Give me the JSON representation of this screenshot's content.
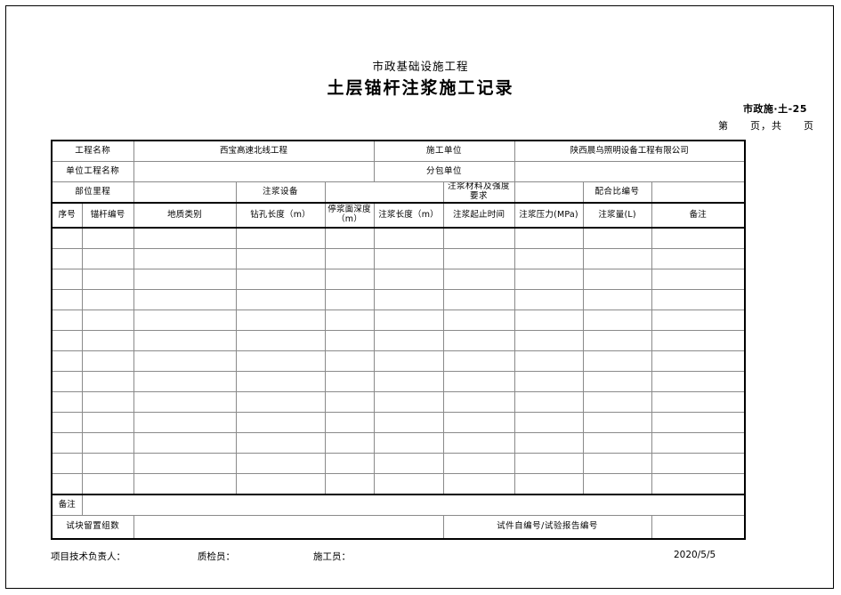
{
  "document": {
    "subtitle": "市政基础设施工程",
    "title": "土层锚杆注浆施工记录",
    "form_code": "市政施·土-25",
    "page_line": "第　　页，共　　页"
  },
  "info": {
    "project_name_label": "工程名称",
    "project_name_value": "西宝高速北线工程",
    "construction_unit_label": "施工单位",
    "construction_unit_value": "陕西晨乌照明设备工程有限公司",
    "unit_project_label": "单位工程名称",
    "unit_project_value": "",
    "subcontractor_label": "分包单位",
    "subcontractor_value": "",
    "location_mileage_label": "部位里程",
    "location_mileage_value": "",
    "grouting_equipment_label": "注浆设备",
    "grouting_equipment_value": "",
    "grouting_material_label": "注浆材料及强度要求",
    "grouting_material_value": "",
    "mix_ratio_label": "配合比编号",
    "mix_ratio_value": ""
  },
  "table": {
    "columns": [
      "序号",
      "锚杆编号",
      "地质类别",
      "钻孔长度（m）",
      "停浆面深度（m）",
      "注浆长度（m）",
      "注浆起止时间",
      "注浆压力(MPa)",
      "注浆量(L)",
      "备注"
    ],
    "rows": [
      [
        "",
        "",
        "",
        "",
        "",
        "",
        "",
        "",
        "",
        ""
      ],
      [
        "",
        "",
        "",
        "",
        "",
        "",
        "",
        "",
        "",
        ""
      ],
      [
        "",
        "",
        "",
        "",
        "",
        "",
        "",
        "",
        "",
        ""
      ],
      [
        "",
        "",
        "",
        "",
        "",
        "",
        "",
        "",
        "",
        ""
      ],
      [
        "",
        "",
        "",
        "",
        "",
        "",
        "",
        "",
        "",
        ""
      ],
      [
        "",
        "",
        "",
        "",
        "",
        "",
        "",
        "",
        "",
        ""
      ],
      [
        "",
        "",
        "",
        "",
        "",
        "",
        "",
        "",
        "",
        ""
      ],
      [
        "",
        "",
        "",
        "",
        "",
        "",
        "",
        "",
        "",
        ""
      ],
      [
        "",
        "",
        "",
        "",
        "",
        "",
        "",
        "",
        "",
        ""
      ],
      [
        "",
        "",
        "",
        "",
        "",
        "",
        "",
        "",
        "",
        ""
      ],
      [
        "",
        "",
        "",
        "",
        "",
        "",
        "",
        "",
        "",
        ""
      ],
      [
        "",
        "",
        "",
        "",
        "",
        "",
        "",
        "",
        "",
        ""
      ],
      [
        "",
        "",
        "",
        "",
        "",
        "",
        "",
        "",
        "",
        ""
      ]
    ]
  },
  "bottom": {
    "remark_label": "备注",
    "remark_value": "",
    "sample_groups_label": "试块留置组数",
    "sample_groups_value": "",
    "sample_code_label": "试件自编号/试验报告编号",
    "sample_code_value": ""
  },
  "footer": {
    "tech_lead": "项目技术负责人：",
    "inspector": "质检员：",
    "site_worker": "施工员：",
    "date": "2020/5/5"
  }
}
